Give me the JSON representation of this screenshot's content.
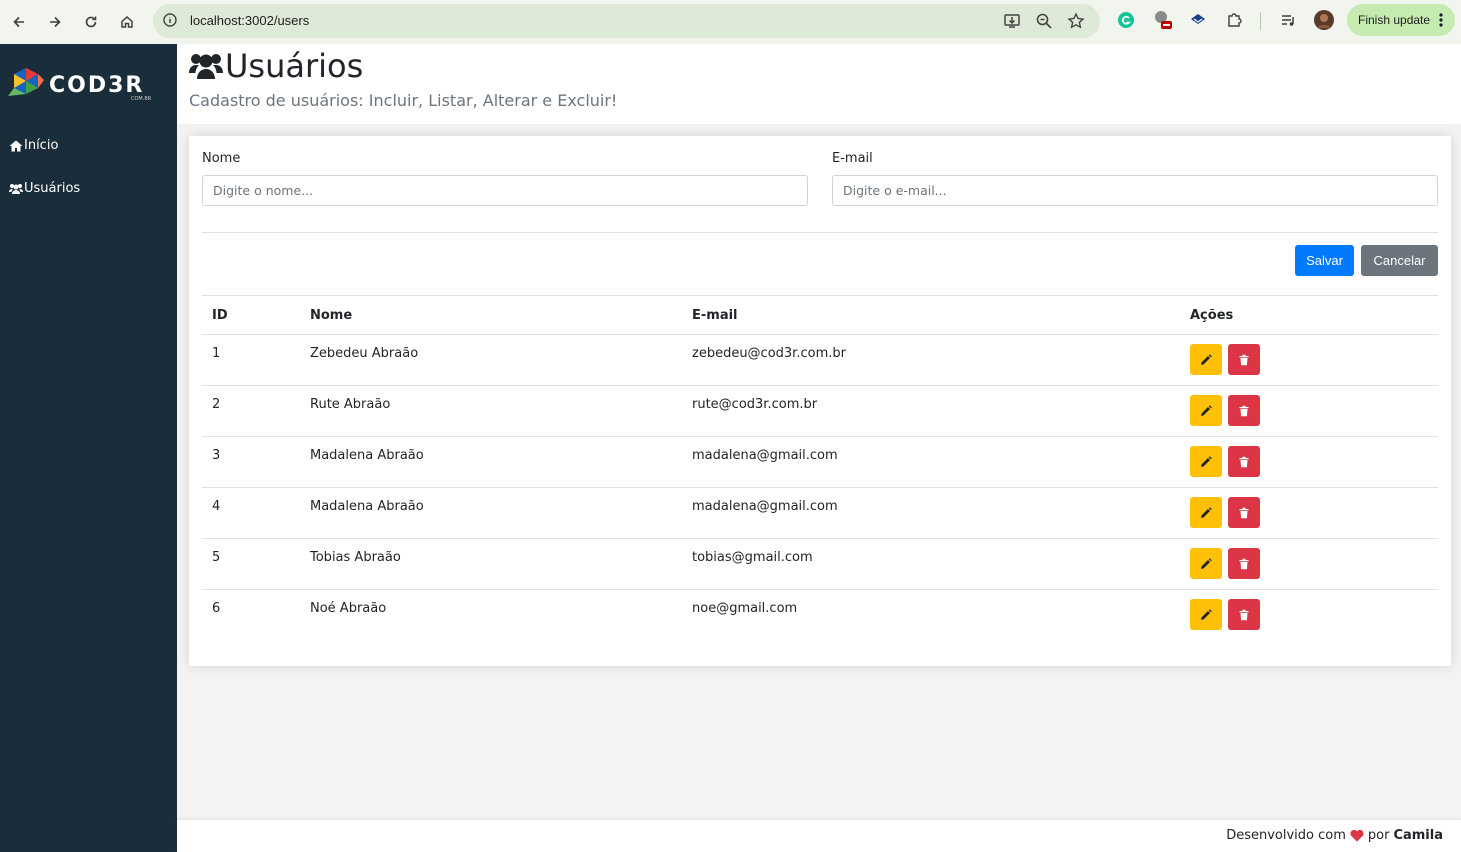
{
  "browser": {
    "url": "localhost:3002/users",
    "finish_update": "Finish update"
  },
  "sidebar": {
    "logo_text": "COD3R",
    "logo_sub": "COM.BR",
    "items": [
      {
        "label": "Início"
      },
      {
        "label": "Usuários"
      }
    ]
  },
  "header": {
    "title": "Usuários",
    "subtitle": "Cadastro de usuários: Incluir, Listar, Alterar e Excluir!"
  },
  "form": {
    "name_label": "Nome",
    "name_placeholder": "Digite o nome...",
    "email_label": "E-mail",
    "email_placeholder": "Digite o e-mail...",
    "save_label": "Salvar",
    "cancel_label": "Cancelar"
  },
  "table": {
    "headers": [
      "ID",
      "Nome",
      "E-mail",
      "Ações"
    ],
    "rows": [
      {
        "id": "1",
        "name": "Zebedeu Abraão",
        "email": "zebedeu@cod3r.com.br"
      },
      {
        "id": "2",
        "name": "Rute Abraão",
        "email": "rute@cod3r.com.br"
      },
      {
        "id": "3",
        "name": "Madalena Abraão",
        "email": "madalena@gmail.com"
      },
      {
        "id": "4",
        "name": "Madalena Abraão",
        "email": "madalena@gmail.com"
      },
      {
        "id": "5",
        "name": "Tobias Abraão",
        "email": "tobias@gmail.com"
      },
      {
        "id": "6",
        "name": "Noé Abraão",
        "email": "noe@gmail.com"
      }
    ]
  },
  "footer": {
    "prefix": "Desenvolvido com",
    "middle": "por",
    "author": "Camila"
  },
  "colors": {
    "sidebar_bg": "#1a2d3a",
    "primary": "#007bff",
    "secondary": "#6c757d",
    "warning": "#ffc107",
    "danger": "#dc3545",
    "heart": "#dc3545"
  }
}
